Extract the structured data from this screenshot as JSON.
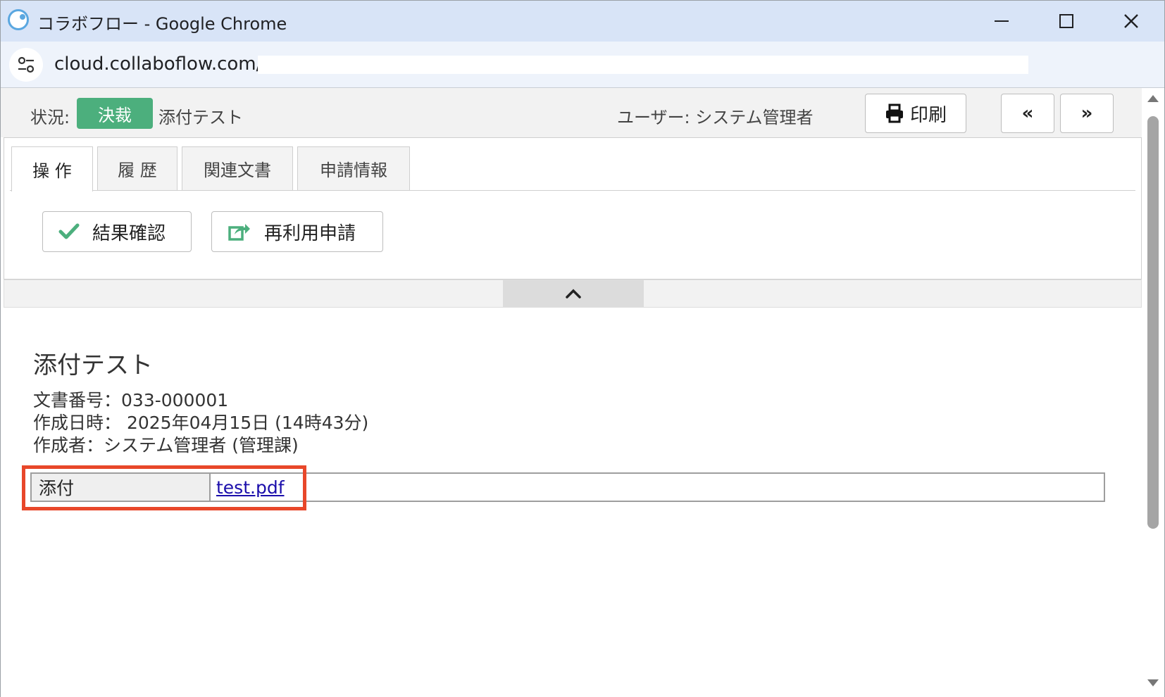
{
  "browser": {
    "window_title": "コラボフロー - Google Chrome",
    "url": "cloud.collaboflow.com/"
  },
  "status_bar": {
    "status_label": "状況:",
    "status_badge": "決裁",
    "document_title": "添付テスト",
    "user_label": "ユーザー: システム管理者",
    "print_label": "印刷",
    "prev_label": "«",
    "next_label": "»"
  },
  "tabs": [
    {
      "label": "操 作",
      "active": true
    },
    {
      "label": "履 歴",
      "active": false
    },
    {
      "label": "関連文書",
      "active": false
    },
    {
      "label": "申請情報",
      "active": false
    }
  ],
  "actions": [
    {
      "label": "結果確認",
      "icon": "check-icon"
    },
    {
      "label": "再利用申請",
      "icon": "share-icon"
    }
  ],
  "document": {
    "title": "添付テスト",
    "number": "文書番号：033-000001",
    "created_at": "作成日時： 2025年04月15日 (14時43分)",
    "author": "作成者：システム管理者 (管理課)",
    "attachment_label": "添付",
    "attachment_file": "test.pdf"
  },
  "colors": {
    "status_badge": "#4caf7d",
    "highlight": "#e8472a",
    "link": "#1a0dab",
    "check_icon": "#4caf7d"
  }
}
